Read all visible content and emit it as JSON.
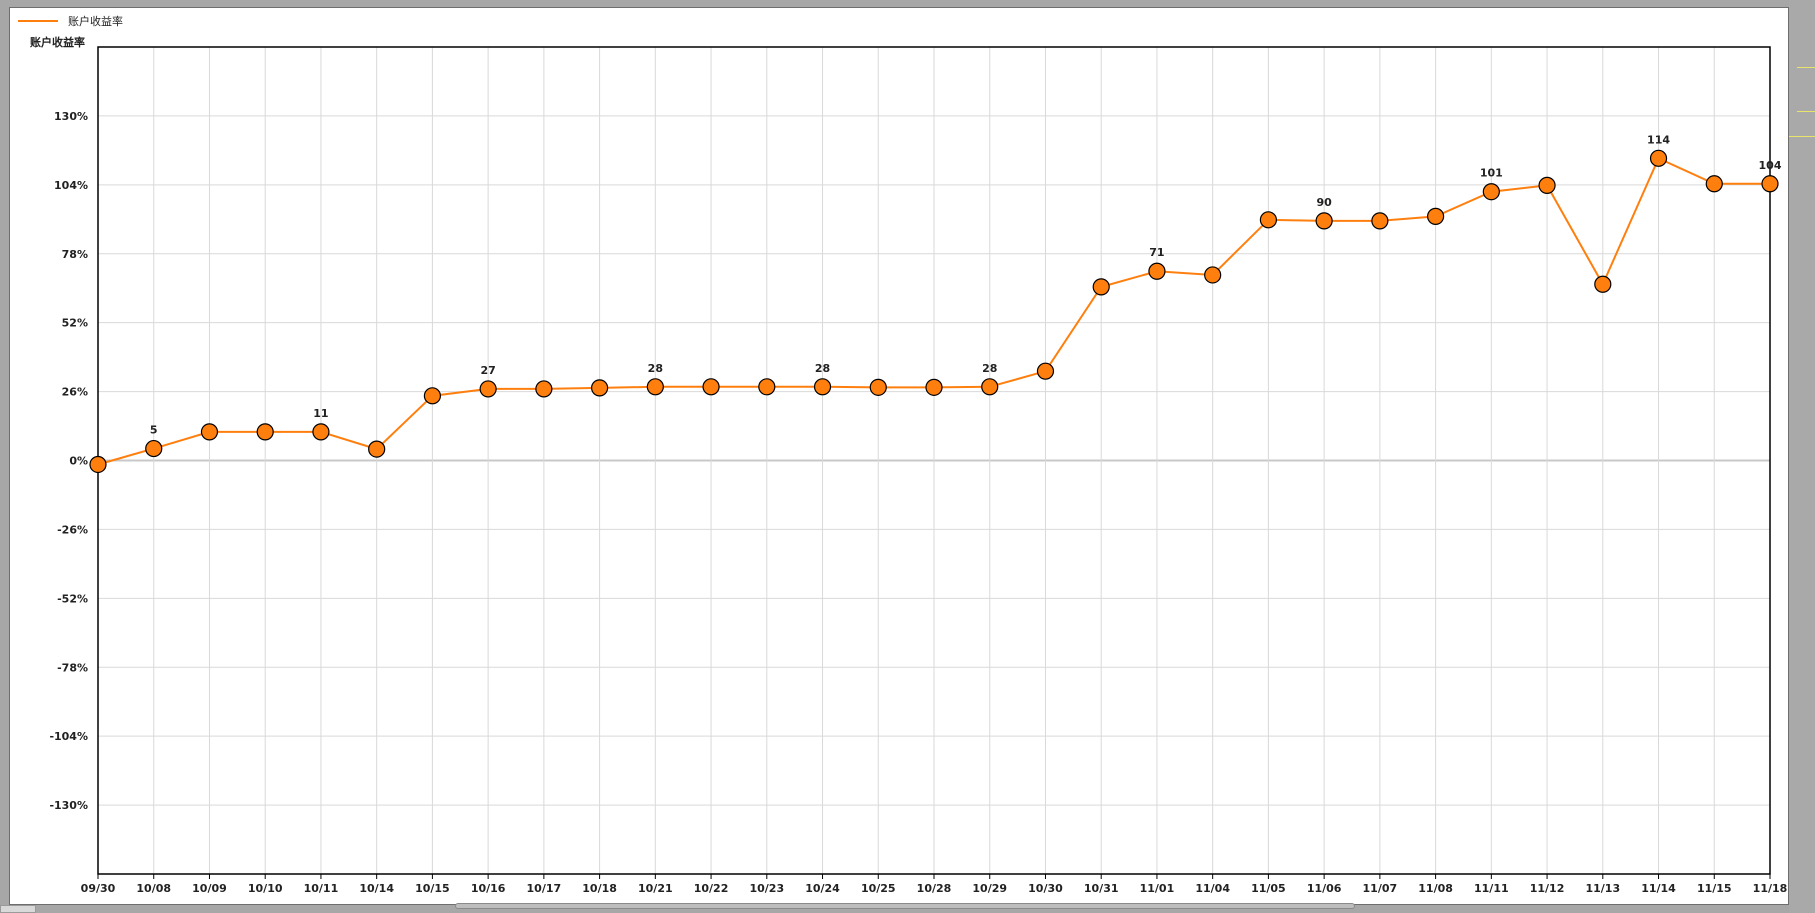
{
  "chart_data": {
    "type": "line",
    "title": "",
    "legend": {
      "placement": "top-left",
      "entries": [
        "账户收益率"
      ]
    },
    "ylabel": "账户收益率",
    "xlabel": "",
    "ylim": [
      -156,
      156
    ],
    "yticks": [
      -130,
      -104,
      -78,
      -52,
      -26,
      0,
      26,
      52,
      78,
      104,
      130
    ],
    "ytick_suffix": "%",
    "grid": true,
    "categories": [
      "09/30",
      "10/08",
      "10/09",
      "10/10",
      "10/11",
      "10/14",
      "10/15",
      "10/16",
      "10/17",
      "10/18",
      "10/21",
      "10/22",
      "10/23",
      "10/24",
      "10/25",
      "10/28",
      "10/29",
      "10/30",
      "10/31",
      "11/01",
      "11/04",
      "11/05",
      "11/06",
      "11/07",
      "11/08",
      "11/11",
      "11/12",
      "11/13",
      "11/14",
      "11/15",
      "11/18"
    ],
    "series": [
      {
        "name": "账户收益率",
        "color": "#ff7f0e",
        "marker_color": "#ff7f0e",
        "values": [
          -1.5,
          4.5,
          10.8,
          10.8,
          10.8,
          4.3,
          24.4,
          27,
          27,
          27.4,
          27.8,
          27.8,
          27.8,
          27.8,
          27.6,
          27.6,
          27.8,
          33.7,
          65.5,
          71.4,
          70,
          90.8,
          90.4,
          90.4,
          92.1,
          101.4,
          103.8,
          66.5,
          114,
          104.4,
          104.4
        ],
        "data_labels": [
          {
            "index": 1,
            "text": "5"
          },
          {
            "index": 4,
            "text": "11"
          },
          {
            "index": 7,
            "text": "27"
          },
          {
            "index": 10,
            "text": "28"
          },
          {
            "index": 13,
            "text": "28"
          },
          {
            "index": 16,
            "text": "28"
          },
          {
            "index": 19,
            "text": "71"
          },
          {
            "index": 22,
            "text": "90"
          },
          {
            "index": 25,
            "text": "101"
          },
          {
            "index": 28,
            "text": "114"
          },
          {
            "index": 30,
            "text": "104"
          }
        ]
      }
    ]
  },
  "colors": {
    "background": "#a7a7a7",
    "panel": "#ffffff",
    "grid": "#d9d9d9",
    "zero_line": "#c8c8c8",
    "axis": "#000000"
  }
}
